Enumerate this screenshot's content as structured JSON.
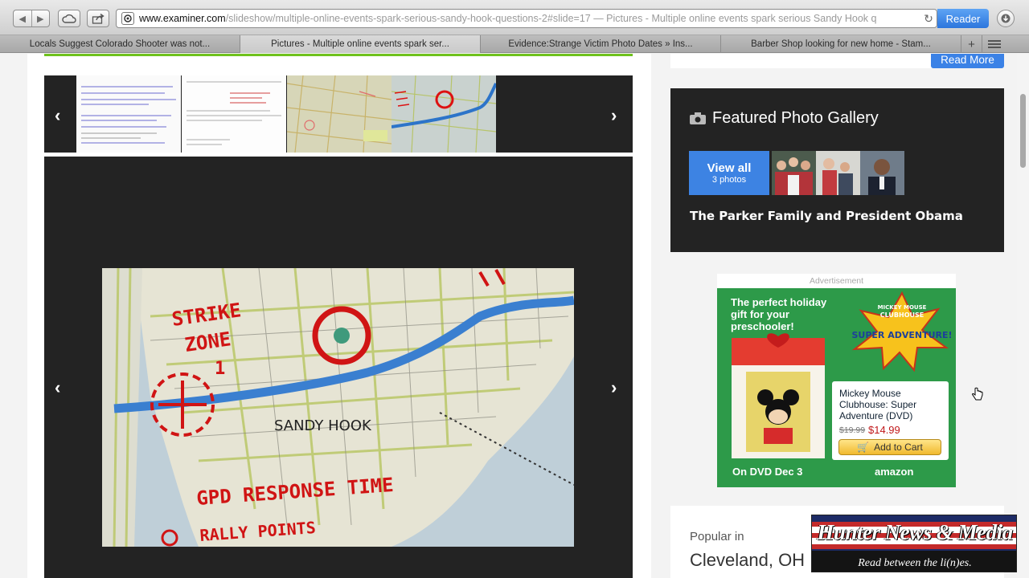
{
  "browser": {
    "url_host": "www.examiner.com",
    "url_path": "/slideshow/multiple-online-events-spark-serious-sandy-hook-questions-2#slide=17",
    "url_page_title": " — Pictures - Multiple online events spark serious Sandy Hook q",
    "reader_label": "Reader",
    "tabs": [
      {
        "label": "Locals Suggest Colorado Shooter was not..."
      },
      {
        "label": "Pictures - Multiple online events spark ser..."
      },
      {
        "label": "Evidence:Strange Victim Photo Dates » Ins..."
      },
      {
        "label": "Barber Shop looking for new home - Stam..."
      }
    ],
    "new_tab_label": "+"
  },
  "sidebar": {
    "read_more_label": "Read More",
    "gallery": {
      "heading": "Featured Photo Gallery",
      "view_all_label": "View all",
      "photo_count_label": "3 photos",
      "caption": "The Parker Family and President Obama"
    },
    "ad": {
      "label": "Advertisement",
      "headline": "The perfect holiday gift for your preschooler!",
      "product_title": "Mickey Mouse Clubhouse: Super Adventure (DVD)",
      "old_price": "$19.99",
      "new_price": "$14.99",
      "cart_label": "Add to Cart",
      "release_line": "On DVD Dec 3",
      "retailer": "amazon",
      "brand_line1": "MICKEY MOUSE",
      "brand_line2": "CLUBHOUSE",
      "brand_title": "SUPER ADVENTURE!"
    },
    "popular": {
      "label": "Popular in",
      "city": "Cleveland, OH"
    }
  },
  "slideshow": {
    "map_labels": {
      "strike_zone": "STRIKE ZONE 1",
      "sandy_hook": "SANDY HOOK",
      "response_time": "GPD RESPONSE TIME",
      "rally_points": "RALLY POINTS"
    }
  },
  "watermark": {
    "line1": "Hunter News & Media",
    "line2": "Read between the li(n)es."
  }
}
